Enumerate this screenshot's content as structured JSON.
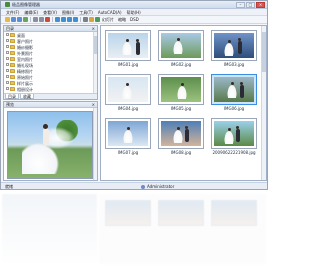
{
  "window": {
    "title": "极品图像管理器",
    "buttons": {
      "minimize": "–",
      "maximize": "□",
      "close": "×"
    }
  },
  "menu": [
    "文件(F)",
    "编辑(E)",
    "查看(V)",
    "图像(I)",
    "工具(T)",
    "AutoCAD(A)",
    "帮助(H)"
  ],
  "toolbar": {
    "icons": [
      {
        "name": "folder-icon",
        "color": "#e2b94a"
      },
      {
        "name": "back-icon",
        "color": "#5c8ed6"
      },
      {
        "name": "forward-icon",
        "color": "#5c8ed6"
      },
      {
        "name": "up-icon",
        "color": "#6aa35b"
      },
      {
        "name": "copy-icon",
        "color": "#8a8fa0"
      },
      {
        "name": "cut-icon",
        "color": "#8a8fa0"
      },
      {
        "name": "delete-icon",
        "color": "#cc4a3d"
      },
      {
        "name": "rotate-left-icon",
        "color": "#3f8fd1"
      },
      {
        "name": "rotate-right-icon",
        "color": "#3f8fd1"
      },
      {
        "name": "zoom-in-icon",
        "color": "#3f8fd1"
      },
      {
        "name": "zoom-out-icon",
        "color": "#3f8fd1"
      },
      {
        "name": "print-icon",
        "color": "#7b7f8c"
      },
      {
        "name": "email-icon",
        "color": "#d8a63c"
      },
      {
        "name": "slideshow-icon",
        "color": "#4a9a5e"
      }
    ],
    "labels": {
      "slideshow": "幻灯片",
      "thumbnail": "缩略",
      "dsd": "DSD"
    }
  },
  "tree": {
    "header": "目录",
    "close": "×",
    "items": [
      "桌面",
      "客户照片",
      "婚纱摄影",
      "外景照片",
      "室内照片",
      "婚礼现场",
      "精修照片",
      "原始照片",
      "样片展示",
      "相册设计",
      "待修照片",
      "图片素材"
    ],
    "tabs": [
      "目录",
      "收藏"
    ]
  },
  "preview": {
    "header": "预览",
    "close": "×"
  },
  "thumbnails": [
    {
      "caption": "IMG01.jpg",
      "selected": false
    },
    {
      "caption": "IMG02.jpg",
      "selected": false
    },
    {
      "caption": "IMG03.jpg",
      "selected": false
    },
    {
      "caption": "IMG04.jpg",
      "selected": false
    },
    {
      "caption": "IMG05.jpg",
      "selected": false
    },
    {
      "caption": "IMG06.jpg",
      "selected": true
    },
    {
      "caption": "IMG07.jpg",
      "selected": false
    },
    {
      "caption": "IMG08.jpg",
      "selected": false
    },
    {
      "caption": "20090622221908.jpg",
      "selected": false
    }
  ],
  "status": {
    "left": "就绪",
    "user": "Administrator"
  }
}
